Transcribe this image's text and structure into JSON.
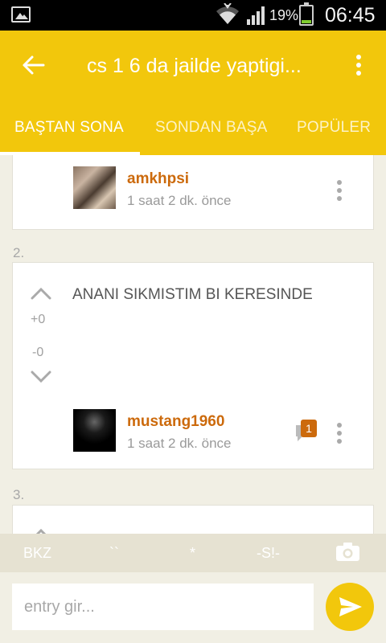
{
  "status_bar": {
    "battery_percent": "19%",
    "time": "06:45"
  },
  "toolbar": {
    "title": "cs 1 6 da jailde yaptigi...",
    "tabs": [
      {
        "label": "BAŞTAN SONA",
        "active": true
      },
      {
        "label": "SONDAN BAŞA",
        "active": false
      },
      {
        "label": "POPÜLER",
        "active": false
      }
    ]
  },
  "entries": [
    {
      "author": "amkhpsi",
      "time": "1 saat 2 dk. önce"
    },
    {
      "number": "2.",
      "text": "ANANI SIKMISTIM BI KERESINDE",
      "upvotes": "+0",
      "downvotes": "-0",
      "author": "mustang1960",
      "time": "1 saat 2 dk. önce",
      "comment_count": "1"
    },
    {
      "number": "3."
    }
  ],
  "format_bar": {
    "buttons": [
      "BKZ",
      "``",
      "*",
      "-S!-"
    ]
  },
  "input": {
    "placeholder": "entry gir..."
  },
  "colors": {
    "accent": "#f2c70c",
    "username": "#cc6a0c",
    "background": "#f1efe4"
  }
}
